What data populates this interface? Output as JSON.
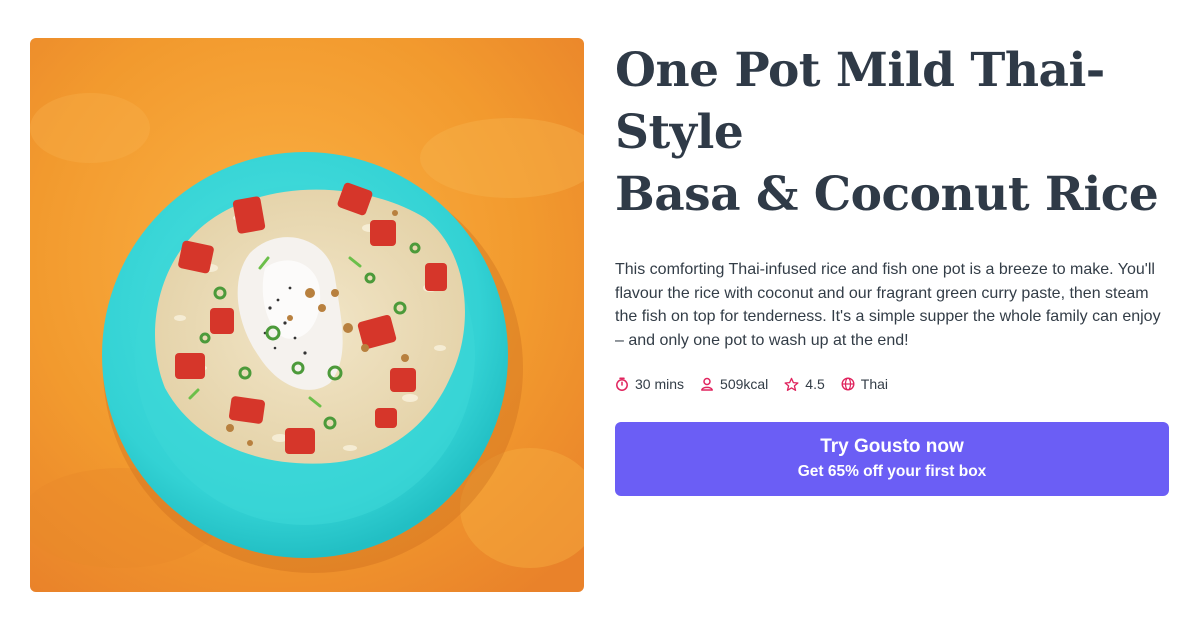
{
  "recipe": {
    "title_line1": "One Pot Mild Thai-Style",
    "title_line2": "Basa & Coconut Rice",
    "description": "This comforting Thai-infused rice and fish one pot is a breeze to make. You'll flavour the rice with coconut and our fragrant green curry paste, then steam the fish on top for tenderness. It's a simple supper the whole family can enjoy – and only one pot to wash up at the end!",
    "meta": {
      "time": "30 mins",
      "calories": "509kcal",
      "rating": "4.5",
      "cuisine": "Thai"
    }
  },
  "cta": {
    "title": "Try Gousto now",
    "subtitle": "Get 65% off your first box"
  },
  "colors": {
    "accent": "#6b5ef5",
    "icon": "#e0245e",
    "title": "#2f3a47",
    "plate": "#3ad6d6",
    "background_orange": "#f39a2c"
  },
  "icons": [
    "timer-icon",
    "person-icon",
    "star-icon",
    "globe-icon"
  ]
}
